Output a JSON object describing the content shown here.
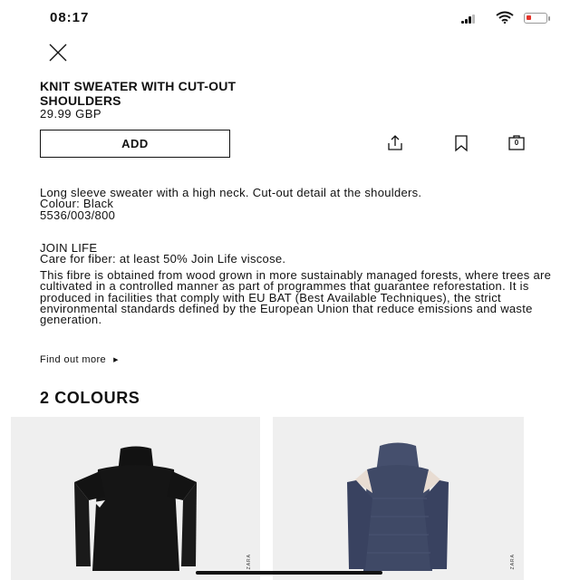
{
  "status_bar": {
    "time": "08:17",
    "battery_color": "#e5332a"
  },
  "icons": {
    "close": "close-icon",
    "share": "share-icon",
    "bookmark": "bookmark-icon",
    "bag": "shopping-bag-icon",
    "signal": "signal-icon",
    "wifi": "wifi-icon",
    "battery": "battery-icon"
  },
  "product": {
    "title": "KNIT SWEATER WITH CUT-OUT SHOULDERS",
    "price": "29.99 GBP",
    "add_label": "ADD"
  },
  "cart": {
    "count": "0"
  },
  "description": {
    "main": "Long sleeve sweater with a high neck. Cut-out detail at the shoulders.",
    "colour": "Colour: Black",
    "reference": "5536/003/800",
    "join_life_heading": "JOIN LIFE",
    "join_life_care": "Care for fiber: at least 50% Join Life viscose.",
    "fibre_text": "This fibre is obtained from wood grown in more sustainably managed forests, where trees are cultivated in a controlled manner as part of programmes that guarantee reforestation. It is produced in facilities that comply with EU BAT (Best Available Techniques), the strict environmental standards defined by the European Union that reduce emissions and waste generation.",
    "find_out_more": "Find out more"
  },
  "colours": {
    "heading": "2 COLOURS",
    "items": [
      {
        "name": "Black",
        "swatch": "#111111",
        "brand": "ZARA"
      },
      {
        "name": "Blue",
        "swatch": "#3d4766",
        "brand": "ZARA"
      }
    ]
  }
}
